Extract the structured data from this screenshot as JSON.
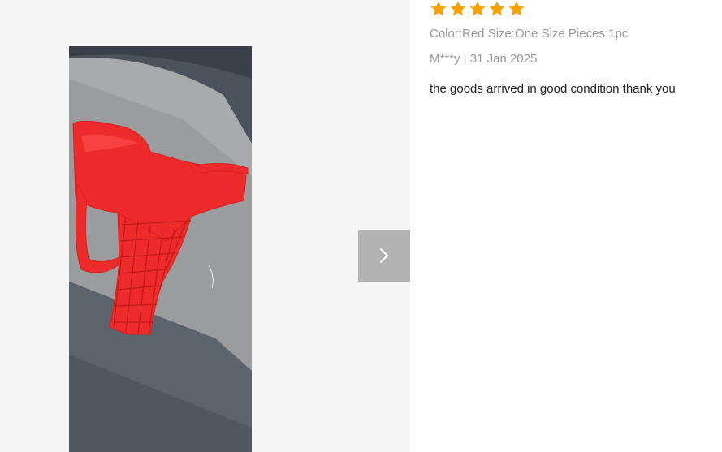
{
  "review": {
    "rating": 5,
    "rating_max": 5,
    "star_color": "#f5a100",
    "sku": "Color:Red Size:One Size Pieces:1pc",
    "author": "M***y",
    "separator": " | ",
    "date": "31 Jan 2025",
    "text": "the goods arrived in good condition thank you"
  },
  "viewer": {
    "next_icon": "chevron-right-icon",
    "photo_subject": "red-mesh-garment-on-car-seat"
  },
  "colors": {
    "viewer_bg": "#f5f5f5",
    "nav_button_bg": "#b3b3b3",
    "meta_text": "#999999",
    "body_text": "#222222"
  }
}
